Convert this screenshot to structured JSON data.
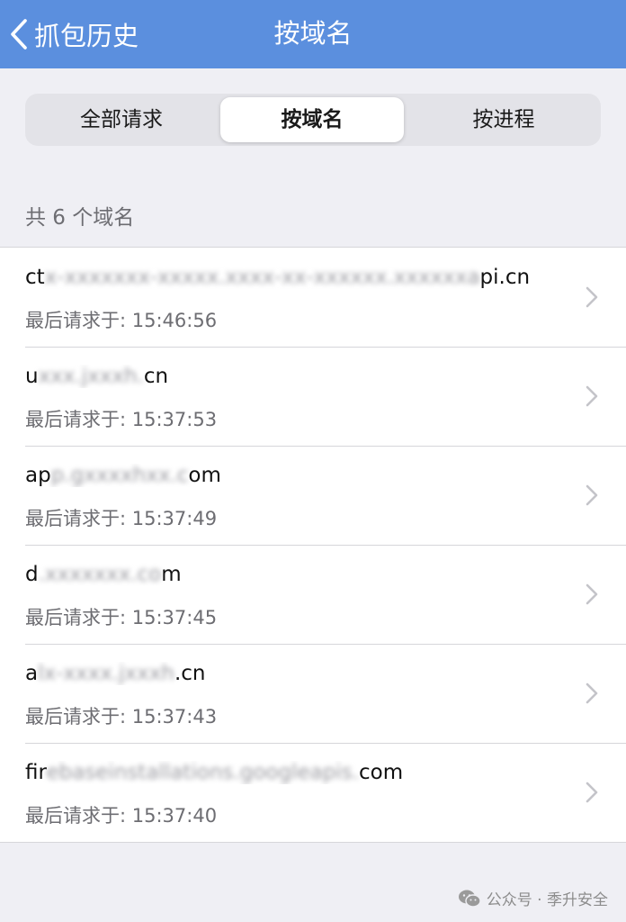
{
  "nav": {
    "back_label": "抓包历史",
    "title": "按域名"
  },
  "segments": [
    {
      "label": "全部请求",
      "selected": false
    },
    {
      "label": "按域名",
      "selected": true
    },
    {
      "label": "按进程",
      "selected": false
    }
  ],
  "count_label": "共 6 个域名",
  "domains": [
    {
      "prefix": "ct",
      "masked": "x-xxxxxxx-xxxxx.xxxx-xx-xxxxxx.xxxxxxa",
      "suffix": "pi.cn",
      "time": "最后请求于: 15:46:56"
    },
    {
      "prefix": "u",
      "masked": "xxx.jxxxh.",
      "suffix": "cn",
      "time": "最后请求于: 15:37:53"
    },
    {
      "prefix": "ap",
      "masked": "p.gxxxxhxx.c",
      "suffix": "om",
      "time": "最后请求于: 15:37:49"
    },
    {
      "prefix": "d",
      "masked": ".xxxxxxx.co",
      "suffix": "m",
      "time": "最后请求于: 15:37:45"
    },
    {
      "prefix": "a",
      "masked": "lx-xxxx.jxxxh",
      "suffix": ".cn",
      "time": "最后请求于: 15:37:43"
    },
    {
      "prefix": "fir",
      "masked": "ebaseinstallations.googleapis.",
      "suffix": "com",
      "time": "最后请求于: 15:37:40"
    }
  ],
  "watermark": {
    "text": "公众号 · 季升安全",
    "icon": "wechat-icon"
  },
  "colors": {
    "nav_background": "#5b8fde",
    "page_background": "#efeff4"
  }
}
